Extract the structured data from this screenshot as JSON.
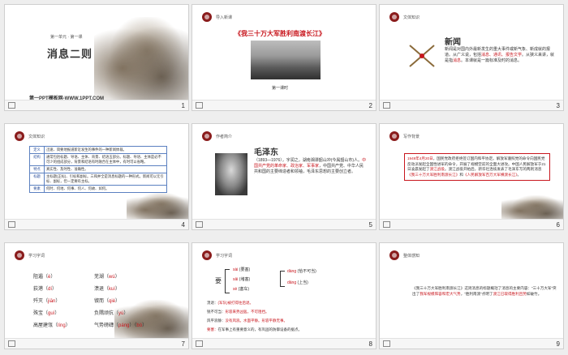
{
  "slides": [
    {
      "num": "1",
      "unit": "第一单元 · 第一课",
      "title": "消息二则",
      "footer": "第一PPT模板网-WWW.1PPT.COM"
    },
    {
      "num": "2",
      "header": "导入新课",
      "title": "《我三十万大军胜利南渡长江》",
      "subtitle": "第一课时"
    },
    {
      "num": "3",
      "header": "文体知识",
      "heading": "新闻",
      "text_a": "新闻是对国内外最新发生的重大事件或新气象、新成就的报道。从广义说，包括",
      "text_red": "消息、通讯、报告文学",
      "text_b": "。从狭义来讲，就是指",
      "text_red2": "消息",
      "text_c": "。本课就是一篇标准及时的消息。"
    },
    {
      "num": "4",
      "header": "文体知识",
      "rows": [
        {
          "k": "定义",
          "v": "迅速、简要地报道新近发生的事件的一种新闻体裁。"
        },
        {
          "k": "结构",
          "v": "通常包括标题、导语、主体、背景、结语五部分。标题、导语、主体是必不可少的组成部分，背景和结语有时融合在主体中，有时可以省略。"
        },
        {
          "k": "特点",
          "v": "真实性、及时性、准确性。"
        },
        {
          "k": "标题",
          "v": "主标题(正标)、引标和副标。三和并全是消息标题的一种形式。新闻可以无引标、副标，但一定要有主标。"
        },
        {
          "k": "要素",
          "v": "何时、何地、何事、何人、何故、如何。"
        }
      ]
    },
    {
      "num": "5",
      "header": "作者简介",
      "name": "毛泽东",
      "bio": "（1893—1976），字润之，湖南湘潭韶山冲(今属韶山市)人。",
      "bio_red": "中国共产党的革命家、政治家、军事家",
      "bio_b": "，中国共产党、中华人民共和国的主要缔造者和领袖，毛泽东思想的主要创立者。"
    },
    {
      "num": "6",
      "header": "写作背景",
      "text_a": "1949年4月20日",
      "text_b": "，国民党政府拒绝签订国内和平协定。解放军遵照党的命令向国民党反动派发起全国性进军的命令，开展了规模空前的全面大进攻。中国人民解放军于21日凌晨发起了",
      "text_red": "渡江战役",
      "text_c": "。渡江战役开始后，新华社连续发表了毛泽东写的两则消息",
      "text_red2": "《我三十万大军胜利南渡长江》",
      "text_d": "和",
      "text_red3": "《人民解放军百万大军横渡长江》",
      "text_e": "。"
    },
    {
      "num": "7",
      "header": "学习字词",
      "lines": [
        [
          "阻遏",
          "è",
          "芜湖",
          "wú"
        ],
        [
          "荻港",
          "dí",
          "溃退",
          "kuì"
        ],
        [
          "歼灭",
          "jiān",
          "锲而",
          "qiè"
        ],
        [
          "殊宝",
          "guì",
          "负隅顽抗",
          "yú"
        ],
        [
          "高屋建瓴",
          "líng",
          "气势磅礴",
          "páng",
          "bó"
        ]
      ]
    },
    {
      "num": "8",
      "header": "学习字词",
      "char": "要",
      "reads": [
        {
          "py": "sài",
          "w": "(要塞)"
        },
        {
          "py": "sāi",
          "w": "(堵塞)"
        },
        {
          "py": "sè",
          "w": "(塞车)"
        }
      ],
      "dang": [
        {
          "py": "dàng",
          "w": "(恰不可当)"
        },
        {
          "py": "dāng",
          "w": "(上当)"
        }
      ],
      "terms": [
        {
          "k": "溃退：",
          "v": "(军队)被打得往后退。"
        },
        {
          "k": "锐不可当：",
          "v": "形容来势凶猛，不可阻挡。"
        },
        {
          "k": "风平浪静：",
          "v": "没有风浪。水面平静。形容平静无事。"
        },
        {
          "k": "要塞：",
          "v": "在军事上有重要意义的，有巩固的防御设备的据点。"
        }
      ]
    },
    {
      "num": "9",
      "header": "整体感知",
      "text_a": "《我三十万大军胜利南渡长江》这则消息的标题概括了消息的主要内容：“三十万大军”突出了",
      "text_red": "我军规模阵容和宏大气势",
      "text_b": "，“胜利南渡”点明了",
      "text_red2": "渡江已取得胜利且势",
      "text_c": "如破竹。"
    }
  ]
}
